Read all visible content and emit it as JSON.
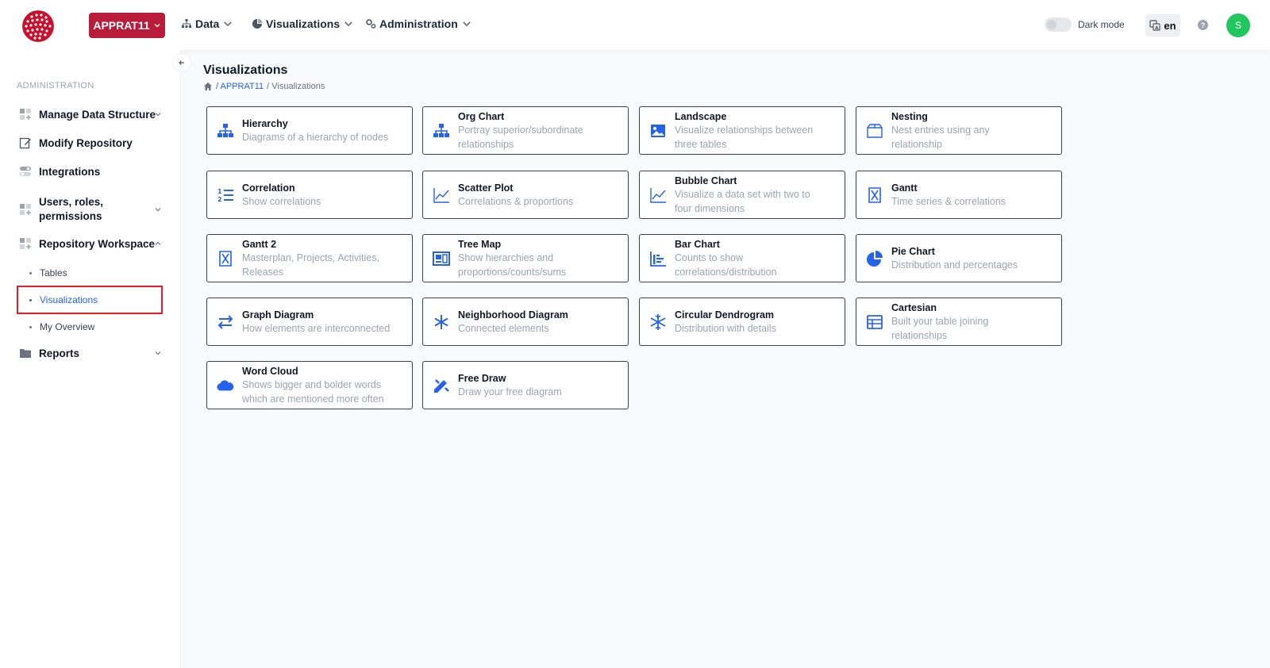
{
  "header": {
    "project_label": "APPRAT11",
    "nav": [
      {
        "label": "Data",
        "icon": "sitemap-icon"
      },
      {
        "label": "Visualizations",
        "icon": "pie-icon"
      },
      {
        "label": "Administration",
        "icon": "cogs-icon"
      }
    ],
    "dark_mode_label": "Dark mode",
    "lang_label": "en",
    "help_glyph": "?",
    "avatar_initial": "S"
  },
  "sidebar": {
    "section_label": "ADMINISTRATION",
    "items": [
      {
        "label": "Manage Data Structure",
        "icon": "grid-plus-icon",
        "has_chevron": true
      },
      {
        "label": "Modify Repository",
        "icon": "edit-icon",
        "has_chevron": false
      },
      {
        "label": "Integrations",
        "icon": "toggles-icon",
        "has_chevron": false
      },
      {
        "label": "Users, roles, permissions",
        "icon": "grid-plus-icon",
        "has_chevron": true
      },
      {
        "label": "Repository Workspace",
        "icon": "grid-plus-icon",
        "has_chevron": true,
        "expanded": true
      }
    ],
    "subitems": [
      {
        "label": "Tables",
        "active": false
      },
      {
        "label": "Visualizations",
        "active": true
      },
      {
        "label": "My Overview",
        "active": false
      }
    ],
    "reports": {
      "label": "Reports",
      "icon": "folder-icon"
    }
  },
  "main": {
    "title": "Visualizations",
    "breadcrumb": {
      "project": "APPRAT11",
      "current": "Visualizations"
    },
    "cards": [
      {
        "title": "Hierarchy",
        "desc": [
          "Diagrams of a hierarchy of nodes"
        ],
        "icon": "sitemap-icon"
      },
      {
        "title": "Org Chart",
        "desc": [
          "Portray superior/subordinate",
          "relationships"
        ],
        "icon": "sitemap-icon"
      },
      {
        "title": "Landscape",
        "desc": [
          "Visualize relationships between",
          "three tables"
        ],
        "icon": "image-icon"
      },
      {
        "title": "Nesting",
        "desc": [
          "Nest entries using any",
          "relationship"
        ],
        "icon": "box-icon"
      },
      {
        "title": "Correlation",
        "desc": [
          "Show correlations"
        ],
        "icon": "list-ordered-icon"
      },
      {
        "title": "Scatter Plot",
        "desc": [
          "Correlations & proportions"
        ],
        "icon": "line-chart-icon"
      },
      {
        "title": "Bubble Chart",
        "desc": [
          "Visualize a data set with two to",
          "four dimensions"
        ],
        "icon": "line-chart-icon"
      },
      {
        "title": "Gantt",
        "desc": [
          "Time series & correlations"
        ],
        "icon": "hourglass-icon"
      },
      {
        "title": "Gantt 2",
        "desc": [
          "Masterplan, Projects, Activities,",
          "Releases"
        ],
        "icon": "hourglass-icon"
      },
      {
        "title": "Tree Map",
        "desc": [
          "Show hierarchies and",
          "proportions/counts/sums"
        ],
        "icon": "treemap-icon"
      },
      {
        "title": "Bar Chart",
        "desc": [
          "Counts to show",
          "correlations/distribution"
        ],
        "icon": "bar-chart-icon"
      },
      {
        "title": "Pie Chart",
        "desc": [
          "Distribution and percentages"
        ],
        "icon": "pie-chart-icon"
      },
      {
        "title": "Graph Diagram",
        "desc": [
          "How elements are interconnected"
        ],
        "icon": "exchange-icon"
      },
      {
        "title": "Neighborhood Diagram",
        "desc": [
          "Connected elements"
        ],
        "icon": "asterisk-icon"
      },
      {
        "title": "Circular Dendrogram",
        "desc": [
          "Distribution with details"
        ],
        "icon": "snowflake-icon"
      },
      {
        "title": "Cartesian",
        "desc": [
          "Built your table joining",
          "relationships"
        ],
        "icon": "table-icon"
      },
      {
        "title": "Word Cloud",
        "desc": [
          "Shows bigger and bolder words",
          "which are mentioned more often"
        ],
        "icon": "cloud-icon"
      },
      {
        "title": "Free Draw",
        "desc": [
          "Draw your free diagram"
        ],
        "icon": "pencil-ruler-icon"
      }
    ]
  },
  "colors": {
    "accent": "#2563eb",
    "brand": "#b91c3a",
    "highlight": "#e11d2a",
    "avatar": "#22c55e"
  }
}
